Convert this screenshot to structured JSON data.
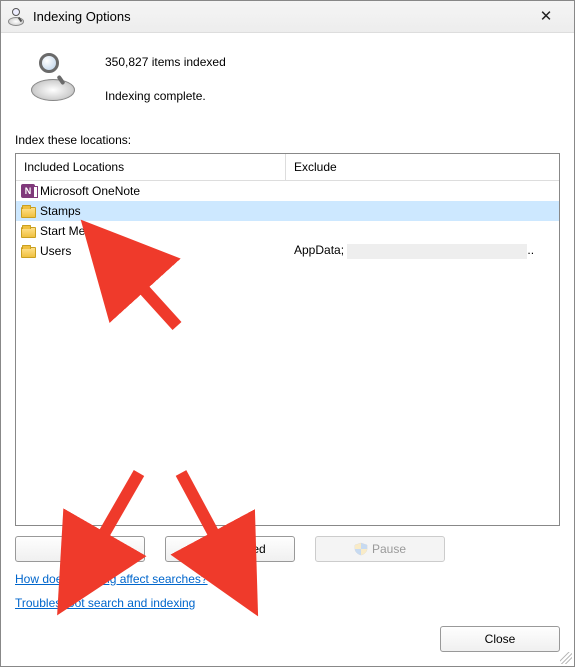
{
  "window": {
    "title": "Indexing Options",
    "close_symbol": "✕"
  },
  "status": {
    "count_line": "350,827 items indexed",
    "state_line": "Indexing complete."
  },
  "sections": {
    "locations_label": "Index these locations:"
  },
  "columns": {
    "included": "Included Locations",
    "exclude": "Exclude"
  },
  "rows": [
    {
      "icon": "onenote",
      "name": "Microsoft OneNote",
      "exclude": "",
      "selected": false
    },
    {
      "icon": "folder",
      "name": "Stamps",
      "exclude": "",
      "selected": true
    },
    {
      "icon": "folder",
      "name": "Start Menu",
      "exclude": "",
      "selected": false
    },
    {
      "icon": "folder",
      "name": "Users",
      "exclude": "AppData; ",
      "exclude_redacted": true,
      "selected": false
    }
  ],
  "buttons": {
    "modify": "Modify",
    "advanced": "Advanced",
    "pause": "Pause",
    "close": "Close"
  },
  "links": {
    "how": "How does indexing affect searches?",
    "troubleshoot": "Troubleshoot search and indexing"
  },
  "icons": {
    "onenote_letter": "N"
  }
}
